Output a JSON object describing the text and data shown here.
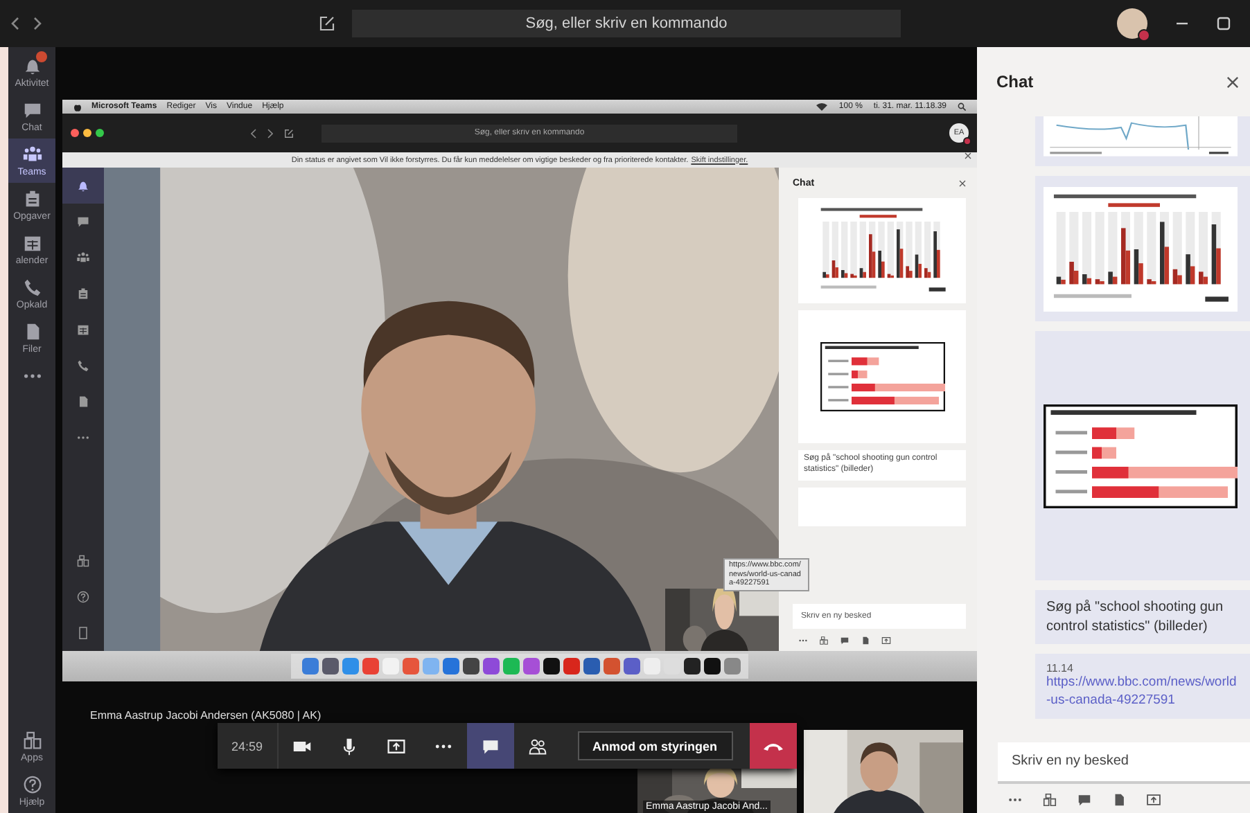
{
  "title_bar": {
    "search_placeholder": "Søg, eller skriv en kommando",
    "status_busy": true
  },
  "sidebar": {
    "items": [
      {
        "kind": "bell",
        "label": "Aktivitet",
        "selected": false,
        "badge": true
      },
      {
        "kind": "chat",
        "label": "Chat",
        "selected": false,
        "badge": false
      },
      {
        "kind": "teams",
        "label": "Teams",
        "selected": true,
        "badge": false
      },
      {
        "kind": "tasks",
        "label": "Opgaver",
        "selected": false,
        "badge": false
      },
      {
        "kind": "calendar",
        "label": "alender",
        "selected": false,
        "badge": false
      },
      {
        "kind": "phone",
        "label": "Opkald",
        "selected": false,
        "badge": false
      },
      {
        "kind": "file",
        "label": "Filer",
        "selected": false,
        "badge": false
      },
      {
        "kind": "more",
        "selected": false,
        "badge": false
      }
    ],
    "bottom_items": [
      {
        "kind": "apps",
        "label": "Apps"
      },
      {
        "kind": "help",
        "label": "Hjælp"
      }
    ]
  },
  "shared_screen": {
    "menu_bar": {
      "app": "Microsoft Teams",
      "menus": [
        "Rediger",
        "Vis",
        "Vindue",
        "Hjælp"
      ],
      "battery": "100 %",
      "clock": "ti. 31. mar. 11.18.39"
    },
    "search_placeholder": "Søg, eller skriv en kommando",
    "avatar_initials": "EA",
    "status_busy": true,
    "banner": {
      "text": "Din status er angivet som Vil ikke forstyrres. Du får kun meddelelser om vigtige beskeder og fra prioriterede kontakter.",
      "link": "Skift indstillinger."
    },
    "sidebar": [
      {
        "kind": "bell",
        "selected": true
      },
      {
        "kind": "chat",
        "selected": false
      },
      {
        "kind": "teams",
        "selected": false
      },
      {
        "kind": "tasks",
        "selected": false
      },
      {
        "kind": "calendar",
        "selected": false
      },
      {
        "kind": "phone",
        "selected": false
      },
      {
        "kind": "file",
        "selected": false
      },
      {
        "kind": "more",
        "selected": false
      }
    ],
    "sidebar_bottom": [
      {
        "kind": "apps"
      },
      {
        "kind": "help"
      },
      {
        "kind": "device"
      }
    ],
    "chat": {
      "title": "Chat",
      "messages": [
        {
          "kind": "columnchart"
        },
        {
          "kind": "barchart"
        },
        {
          "kind": "text",
          "text": "Søg på \"school shooting gun control statistics\" (billeder)"
        },
        {
          "kind": "covered"
        }
      ],
      "compose_placeholder": "Skriv en ny besked"
    },
    "tooltip": "https://www.bbc.com/news/world-us-canada-49227591"
  },
  "presenter": "Emma Aastrup Jacobi Andersen (AK5080 | AK)",
  "call_toolbar": {
    "timer": "24:59",
    "controls": [
      {
        "kind": "camera",
        "selected": false
      },
      {
        "kind": "mic",
        "selected": false
      },
      {
        "kind": "share",
        "selected": false
      },
      {
        "kind": "more",
        "selected": false
      },
      {
        "kind": "chat",
        "selected": true
      },
      {
        "kind": "people",
        "selected": false
      }
    ],
    "request_button": "Anmod om styringen"
  },
  "participants": [
    {
      "kind": "woman",
      "name": "Emma Aastrup Jacobi And..."
    },
    {
      "kind": "man"
    }
  ],
  "chat_panel": {
    "title": "Chat",
    "messages": [
      {
        "kind": "linechart"
      },
      {
        "kind": "columnchart"
      },
      {
        "kind": "barchart"
      },
      {
        "kind": "text",
        "text": "Søg på \"school shooting gun control statistics\" (billeder)"
      },
      {
        "kind": "link",
        "time": "11.14",
        "link": "https://www.bbc.com/news/world-us-canada-49227591"
      }
    ],
    "compose_placeholder": "Skriv en ny besked"
  }
}
